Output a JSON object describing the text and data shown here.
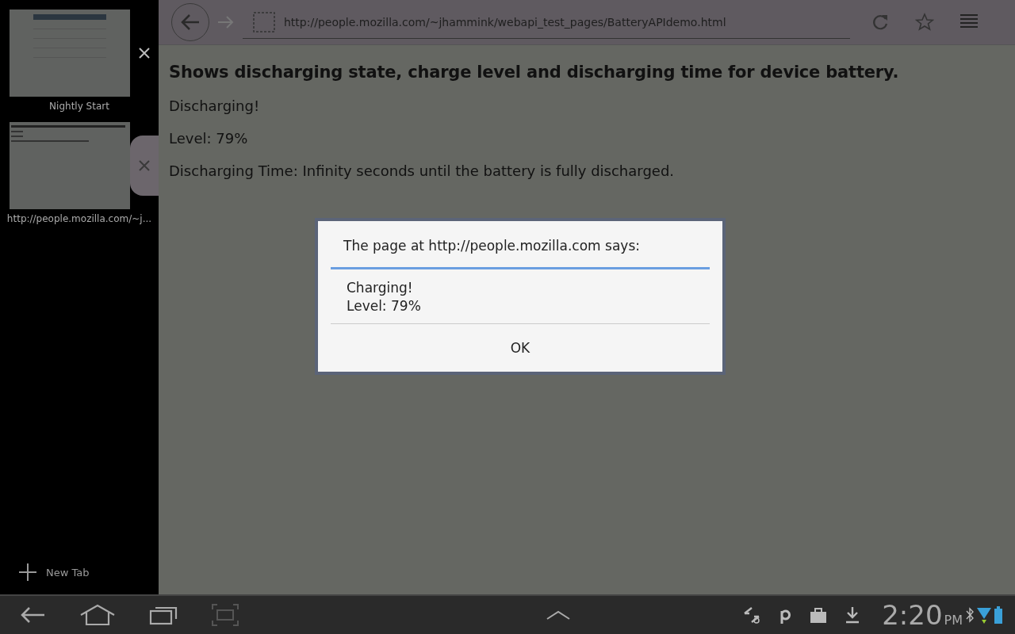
{
  "tabs": [
    {
      "title": "Nightly Start",
      "selected": false,
      "kind": "start"
    },
    {
      "title": "http://people.mozilla.com/~j...",
      "selected": true,
      "kind": "page"
    }
  ],
  "new_tab": {
    "label": "New Tab"
  },
  "toolbar": {
    "url": "http://people.mozilla.com/~jhammink/webapi_test_pages/BatteryAPIdemo.html"
  },
  "page": {
    "heading": "Shows discharging state, charge level and discharging time for device battery.",
    "lines": [
      "Discharging!",
      "Level: 79%",
      "Discharging Time: Infinity seconds until the battery is fully discharged."
    ]
  },
  "dialog": {
    "title": "The page at http://people.mozilla.com says:",
    "message": [
      "Charging!",
      "Level: 79%"
    ],
    "button": "OK"
  },
  "status_bar": {
    "time": "2:20",
    "ampm": "PM"
  }
}
